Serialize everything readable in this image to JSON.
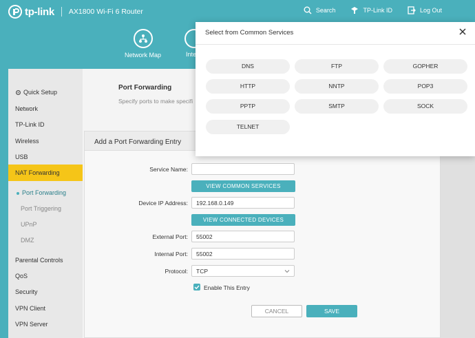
{
  "brand": {
    "logo_text": "tp-link",
    "model": "AX1800 Wi-Fi 6 Router"
  },
  "top_actions": [
    {
      "label": "Search",
      "icon": "search-icon"
    },
    {
      "label": "TP-Link ID",
      "icon": "tplink-id-icon"
    },
    {
      "label": "Log Out",
      "icon": "logout-icon"
    }
  ],
  "nav": {
    "network_map": "Network Map",
    "internet_partial": "Inte"
  },
  "sidebar": {
    "items": [
      "Quick Setup",
      "Network",
      "TP-Link ID",
      "Wireless",
      "USB",
      "NAT Forwarding"
    ],
    "sub_items": [
      "Port Forwarding",
      "Port Triggering",
      "UPnP",
      "DMZ"
    ],
    "lower_items": [
      "Parental Controls",
      "QoS",
      "Security",
      "VPN Client",
      "VPN Server"
    ]
  },
  "main": {
    "title": "Port Forwarding",
    "description": "Specify ports to make specifi"
  },
  "entry": {
    "title": "Add a Port Forwarding Entry",
    "service_name_label": "Service Name:",
    "service_name_value": "",
    "view_common_label": "VIEW COMMON SERVICES",
    "device_ip_label": "Device IP Address:",
    "device_ip_value": "192.168.0.149",
    "view_connected_label": "VIEW CONNECTED DEVICES",
    "external_port_label": "External Port:",
    "external_port_value": "55002",
    "internal_port_label": "Internal Port:",
    "internal_port_value": "55002",
    "protocol_label": "Protocol:",
    "protocol_value": "TCP",
    "enable_label": "Enable This Entry",
    "cancel_label": "CANCEL",
    "save_label": "SAVE"
  },
  "modal": {
    "title": "Select from Common Services",
    "services": [
      "DNS",
      "FTP",
      "GOPHER",
      "HTTP",
      "NNTP",
      "POP3",
      "PPTP",
      "SMTP",
      "SOCK",
      "TELNET"
    ]
  },
  "colors": {
    "accent": "#4ab0bc",
    "highlight": "#f5c518"
  }
}
